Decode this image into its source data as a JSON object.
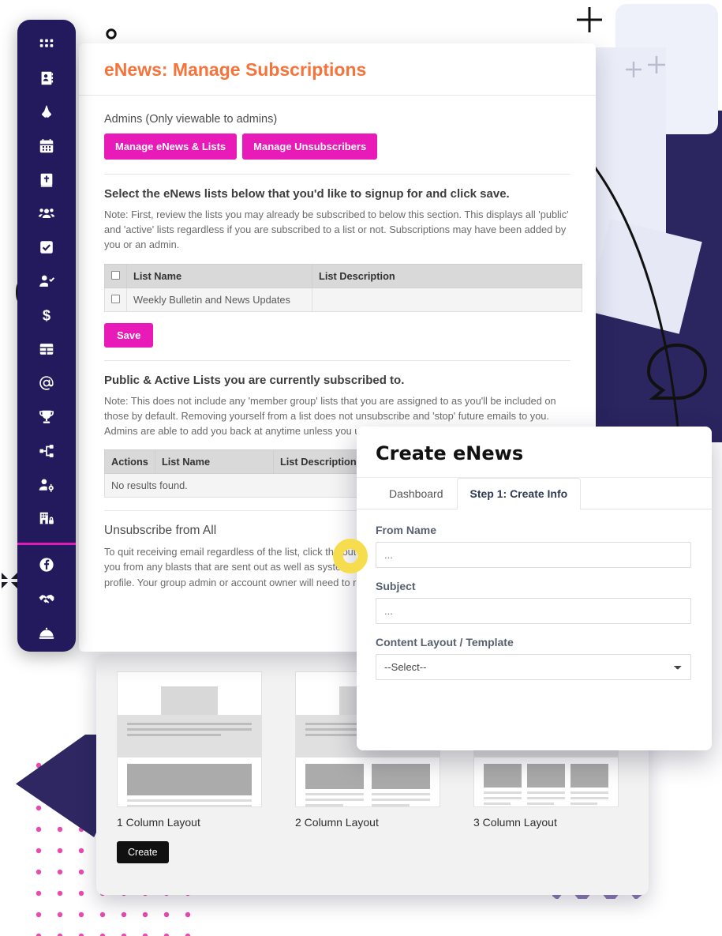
{
  "sidebar": {
    "items": [
      {
        "name": "apps-grid-icon",
        "label": "Apps"
      },
      {
        "name": "contact-book-icon",
        "label": "Directory"
      },
      {
        "name": "praying-hands-icon",
        "label": "Prayer"
      },
      {
        "name": "calendar-icon",
        "label": "Calendar"
      },
      {
        "name": "bible-icon",
        "label": "Bible"
      },
      {
        "name": "people-group-icon",
        "label": "Groups"
      },
      {
        "name": "checkbox-icon",
        "label": "Tasks"
      },
      {
        "name": "user-check-icon",
        "label": "Check-In"
      },
      {
        "name": "dollar-sign-icon",
        "label": "Giving"
      },
      {
        "name": "table-icon",
        "label": "Forms"
      },
      {
        "name": "at-sign-icon",
        "label": "eNews"
      },
      {
        "name": "trophy-icon",
        "label": "Awards"
      },
      {
        "name": "sitemap-icon",
        "label": "Workflow"
      },
      {
        "name": "user-gear-icon",
        "label": "Admin"
      },
      {
        "name": "building-lock-icon",
        "label": "Security"
      }
    ],
    "footer_items": [
      {
        "name": "facebook-icon",
        "label": "Facebook"
      },
      {
        "name": "handshake-icon",
        "label": "Volunteer"
      },
      {
        "name": "concierge-bell-icon",
        "label": "Support"
      }
    ],
    "accent_color": "#e21ab5",
    "background_color": "#231a5e"
  },
  "main": {
    "title": "eNews: Manage Subscriptions",
    "title_color": "#f4743b",
    "admins_label": "Admins (Only viewable to admins)",
    "admin_buttons": [
      {
        "label": "Manage eNews & Lists"
      },
      {
        "label": "Manage Unsubscribers"
      }
    ],
    "select_heading": "Select the eNews lists below that you'd like to signup for and click save.",
    "select_note": "Note: First, review the lists you may already be subscribed to below this section. This displays all 'public' and 'active' lists regardless if you are subscribed to a list or not. Subscriptions may have been added by you or an admin.",
    "signup_table": {
      "headers": [
        "",
        "List Name",
        "List Description"
      ],
      "rows": [
        {
          "name": "Weekly Bulletin and News Updates",
          "description": ""
        }
      ]
    },
    "save_label": "Save",
    "subscribed_heading": "Public & Active Lists you are currently subscribed to.",
    "subscribed_note": "Note: This does not include any 'member group' lists that you are assigned to as you'll be included on those by default. Removing yourself from a list does not unsubscribe and 'stop' future emails to you. Admins are able to add you back at anytime unless you unsubscribe link in an email that you received.",
    "subscribed_table": {
      "headers": [
        "Actions",
        "List Name",
        "List Description"
      ],
      "empty_text": "No results found."
    },
    "unsubscribe_heading": "Unsubscribe from All",
    "unsubscribe_note": "To quit receiving email regardless of the list, click the button below to be unsubscribed. This will remove you from any blasts that are sent out as well as system notifications that may apply to your member profile. Your group admin or account owner will need to remove your member record entirely."
  },
  "templates": {
    "items": [
      {
        "label": "1 Column Layout",
        "columns": 1
      },
      {
        "label": "2 Column Layout",
        "columns": 2
      },
      {
        "label": "3 Column Layout",
        "columns": 3
      }
    ],
    "create_label": "Create"
  },
  "modal": {
    "title": "Create eNews",
    "tabs": [
      {
        "label": "Dashboard",
        "active": false
      },
      {
        "label": "Step 1: Create Info",
        "active": true
      }
    ],
    "fields": {
      "from_name_label": "From Name",
      "from_name_value": "",
      "from_name_placeholder": "...",
      "subject_label": "Subject",
      "subject_value": "",
      "subject_placeholder": "...",
      "template_label": "Content Layout / Template",
      "template_selected": "--Select--"
    }
  }
}
